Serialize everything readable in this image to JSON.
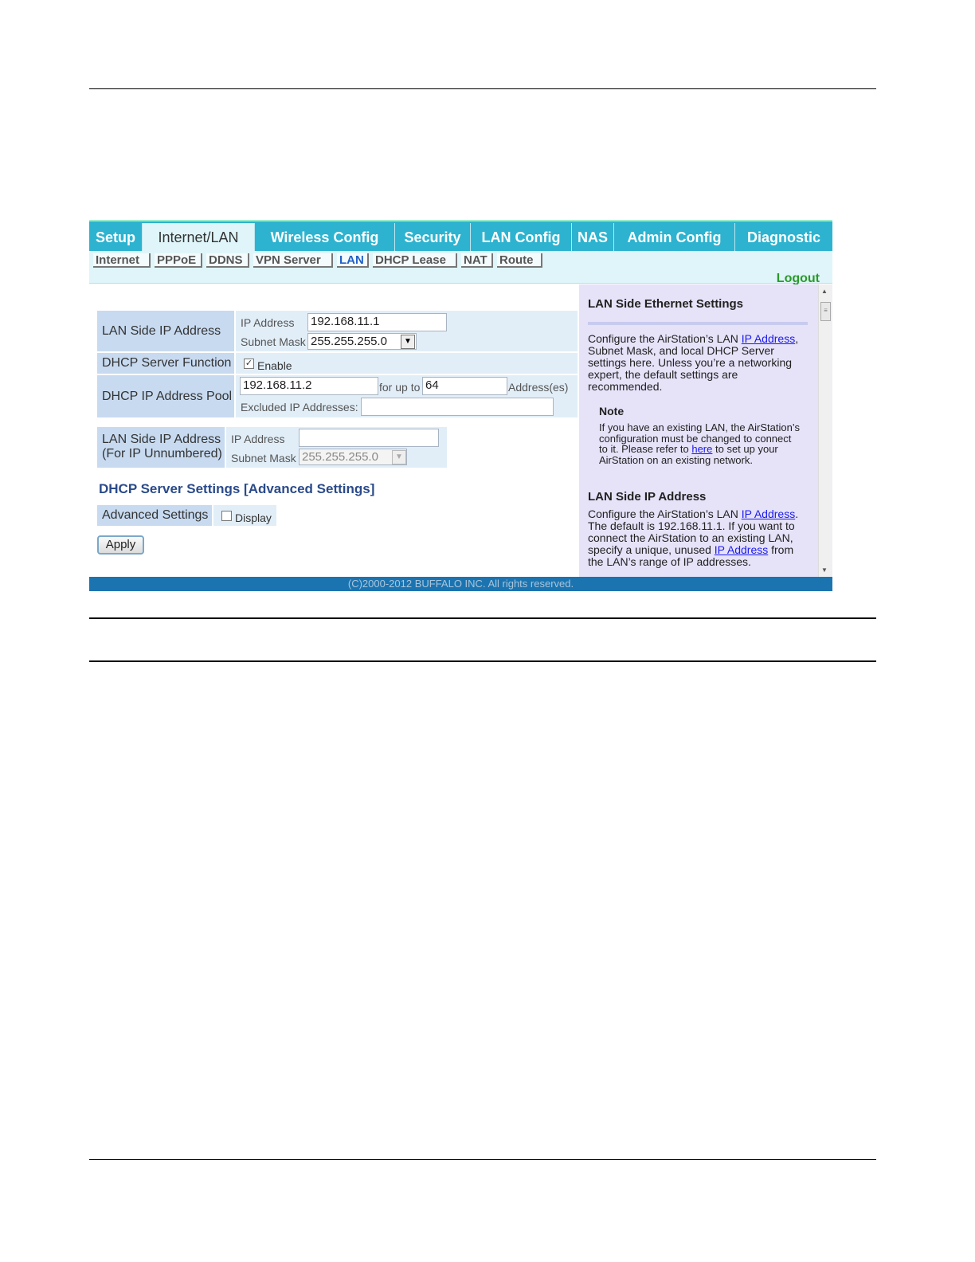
{
  "main_tabs": [
    "Setup",
    "Internet/LAN",
    "Wireless Config",
    "Security",
    "LAN Config",
    "NAS",
    "Admin Config",
    "Diagnostic"
  ],
  "active_main_tab": "Internet/LAN",
  "sub_tabs": [
    "Internet",
    "PPPoE",
    "DDNS",
    "VPN Server",
    "LAN",
    "DHCP Lease",
    "NAT",
    "Route"
  ],
  "active_sub_tab": "LAN",
  "logout_label": "Logout",
  "form": {
    "lan_ip": {
      "label": "LAN Side IP Address",
      "ip_label": "IP Address",
      "ip_value": "192.168.11.1",
      "mask_label": "Subnet Mask",
      "mask_value": "255.255.255.0"
    },
    "dhcp_function": {
      "label": "DHCP Server Function",
      "enable_label": "Enable",
      "enabled": true
    },
    "dhcp_pool": {
      "label": "DHCP IP Address Pool",
      "start_value": "192.168.11.2",
      "for_up_to_label": "for up to",
      "count_value": "64",
      "addresses_label": "Address(es)",
      "excluded_label": "Excluded IP Addresses:",
      "excluded_value": ""
    },
    "unnumbered": {
      "label_line1": "LAN Side IP Address",
      "label_line2": "(For IP Unnumbered)",
      "ip_label": "IP Address",
      "ip_value": "",
      "mask_label": "Subnet Mask",
      "mask_value": "255.255.255.0"
    },
    "advanced_title": "DHCP Server Settings [Advanced Settings]",
    "advanced": {
      "label": "Advanced Settings",
      "display_label": "Display",
      "checked": false
    },
    "apply_label": "Apply"
  },
  "help": {
    "title1": "LAN Side Ethernet Settings",
    "p1_a": "Configure the AirStation’s LAN ",
    "p1_link": "IP Address",
    "p1_b": ", Subnet Mask, and local DHCP Server settings here. Unless you’re a networking expert, the default settings are recommended.",
    "note_title": "Note",
    "note_a": "If you have an existing LAN, the AirStation’s configuration must be changed to connect to it. Please refer to ",
    "note_link": "here",
    "note_b": " to set up your AirStation on an existing network.",
    "title2": "LAN Side IP Address",
    "p2_a": "Configure the AirStation’s LAN ",
    "p2_link1": "IP Address",
    "p2_b": ". The default is 192.168.11.1. If you want to connect the AirStation to an existing LAN, specify a unique, unused ",
    "p2_link2": "IP Address",
    "p2_c": " from the LAN’s range of IP addresses."
  },
  "footer": "(C)2000-2012 BUFFALO INC. All rights reserved."
}
